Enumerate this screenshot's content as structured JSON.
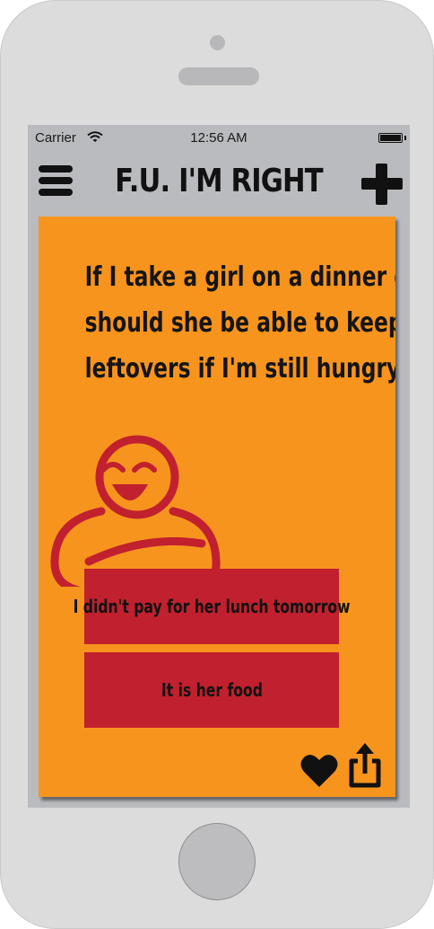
{
  "status_bar": {
    "carrier": "Carrier",
    "time": "12:56 AM",
    "wifi_icon": "wifi-icon",
    "battery_icon": "battery-icon",
    "battery_level": 1.0
  },
  "nav": {
    "title": "F.U. I'M RIGHT",
    "menu_icon": "hamburger-menu-icon",
    "add_icon": "plus-icon"
  },
  "card": {
    "question_lines": [
      "If I take a girl on a dinner date",
      "should she be able to keep her",
      "leftovers if I'm still hungry?"
    ],
    "answers": [
      "I didn't pay for her lunch tomorrow",
      "It is her food"
    ],
    "favorite_icon": "heart-icon",
    "share_icon": "share-icon"
  },
  "colors": {
    "card_background": "#f7941e",
    "answer_button": "#c1202e",
    "mascot": "#c1202e",
    "screen_background": "#babbbe",
    "text": "#151515"
  }
}
